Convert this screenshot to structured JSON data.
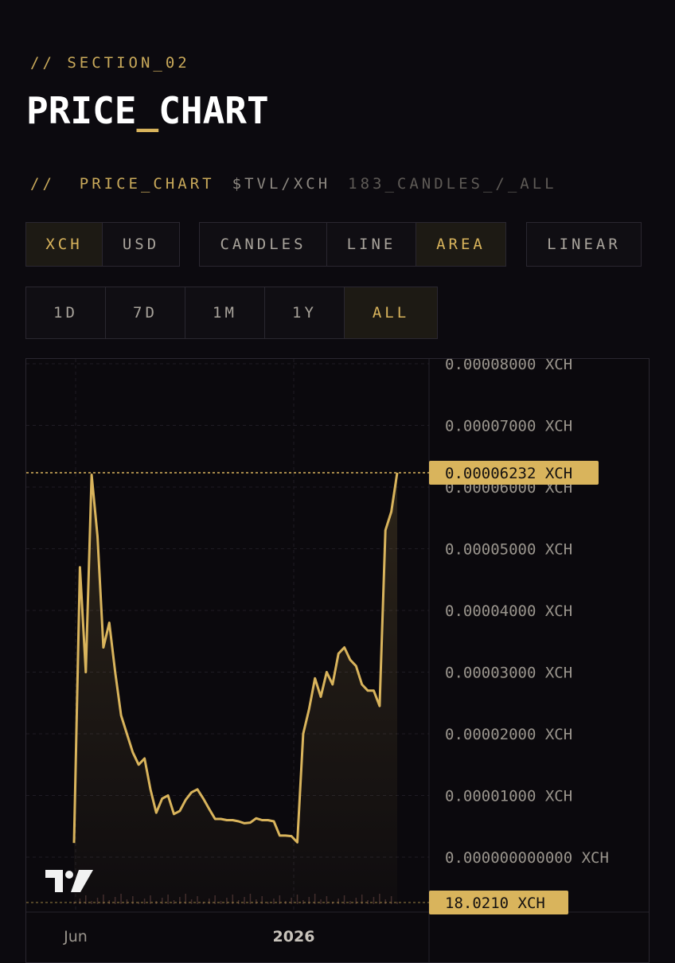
{
  "section": {
    "label": "//  SECTION_02"
  },
  "title": {
    "main": "PRICE",
    "underscore": "_",
    "rest": "CHART"
  },
  "subheader": {
    "slash": "//",
    "name": "PRICE_CHART",
    "pair": "$TVL/XCH",
    "candles": "183_CANDLES_/_ALL"
  },
  "controls": {
    "currency": [
      {
        "label": "XCH",
        "active": true
      },
      {
        "label": "USD",
        "active": false
      }
    ],
    "chart_type": [
      {
        "label": "CANDLES",
        "active": false
      },
      {
        "label": "LINE",
        "active": false
      },
      {
        "label": "AREA",
        "active": true
      }
    ],
    "scale": {
      "label": "LINEAR"
    },
    "ranges": [
      {
        "label": "1D",
        "active": false
      },
      {
        "label": "7D",
        "active": false
      },
      {
        "label": "1M",
        "active": false
      },
      {
        "label": "1Y",
        "active": false
      },
      {
        "label": "ALL",
        "active": true
      }
    ]
  },
  "colors": {
    "accent": "#d9b45c",
    "line": "#d9b45c",
    "background": "#0c0a0f"
  },
  "chart_data": {
    "type": "area",
    "pair": "$TVL/XCH",
    "y_unit": "XCH",
    "ylim": [
      0,
      8e-05
    ],
    "y_ticks": [
      {
        "value": 8e-05,
        "label": "0.00008000 XCH"
      },
      {
        "value": 7e-05,
        "label": "0.00007000 XCH"
      },
      {
        "value": 6e-05,
        "label": "0.00006000 XCH"
      },
      {
        "value": 5e-05,
        "label": "0.00005000 XCH"
      },
      {
        "value": 4e-05,
        "label": "0.00004000 XCH"
      },
      {
        "value": 3e-05,
        "label": "0.00003000 XCH"
      },
      {
        "value": 2e-05,
        "label": "0.00002000 XCH"
      },
      {
        "value": 1e-05,
        "label": "0.00001000 XCH"
      },
      {
        "value": 0,
        "label": "0.000000000000 XCH"
      }
    ],
    "x_ticks": [
      {
        "label": "Jun"
      },
      {
        "label": "2026"
      }
    ],
    "last_price": {
      "value": 6.232e-05,
      "label": "0.00006232 XCH"
    },
    "volume_label": "18.0210 XCH",
    "grid": true,
    "series": [
      {
        "values": [
          2.3e-06,
          4.7e-05,
          3e-05,
          6.2e-05,
          5.2e-05,
          3.4e-05,
          3.8e-05,
          3e-05,
          2.3e-05,
          2e-05,
          1.7e-05,
          1.5e-05,
          1.6e-05,
          1.1e-05,
          7.2e-06,
          9.5e-06,
          1e-05,
          7e-06,
          7.5e-06,
          9.3e-06,
          1.05e-05,
          1.1e-05,
          9.5e-06,
          7.8e-06,
          6.2e-06,
          6.2e-06,
          6e-06,
          6e-06,
          5.8e-06,
          5.5e-06,
          5.6e-06,
          6.3e-06,
          6e-06,
          6e-06,
          5.8e-06,
          3.5e-06,
          3.5e-06,
          3.4e-06,
          2.4e-06,
          2e-05,
          2.4e-05,
          2.9e-05,
          2.6e-05,
          3e-05,
          2.8e-05,
          3.3e-05,
          3.4e-05,
          3.2e-05,
          3.1e-05,
          2.8e-05,
          2.7e-05,
          2.7e-05,
          2.45e-05,
          5.3e-05,
          5.6e-05,
          6.232e-05
        ]
      }
    ]
  }
}
